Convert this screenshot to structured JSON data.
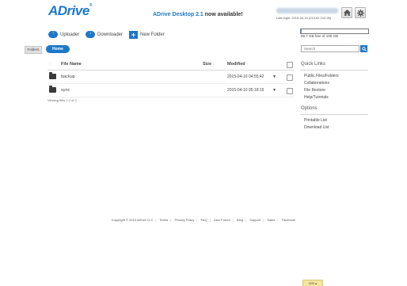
{
  "header": {
    "logo_text": "ADrive",
    "logo_tm": "®",
    "announcement_product": "ADrive Desktop 2.1",
    "announcement_rest": "now available!",
    "last_login": "Last login: 2015-04-10 (213.61.212.96)"
  },
  "toolbar": {
    "uploader_label": "Uploader",
    "downloader_label": "Downloader",
    "new_folder_label": "New Folder"
  },
  "quota": {
    "text": "99.7 GB free of 100 GB",
    "used_fraction": 0.003
  },
  "nav": {
    "folders_label": "Folders",
    "home_label": "Home"
  },
  "search": {
    "placeholder": "Search"
  },
  "table": {
    "col_name": "File Name",
    "col_size": "Size",
    "col_modified": "Modified",
    "rows": [
      {
        "name": "backup",
        "modified": "2015-04-10 04:55:42"
      },
      {
        "name": "sync",
        "modified": "2015-04-10 05:18:15"
      }
    ],
    "viewing": "Viewing files 1-2 of 2"
  },
  "sidebar": {
    "quick_links_title": "Quick Links",
    "quick_links": [
      "Public Files/Folders",
      "Collaborations",
      "File Restore",
      "Help/Tutorials"
    ],
    "options_title": "Options",
    "options": [
      "Printable List",
      "Download List"
    ]
  },
  "footer": {
    "copyright": "Copyright © 2015 ADrive LLC",
    "links": [
      "Terms",
      "Privacy Policy",
      "FAQ",
      "User Forum",
      "Blog",
      "Support",
      "Sales",
      "Facebook"
    ]
  },
  "list_tab": {
    "label": "List"
  },
  "colors": {
    "brand_blue": "#1e78c8"
  }
}
